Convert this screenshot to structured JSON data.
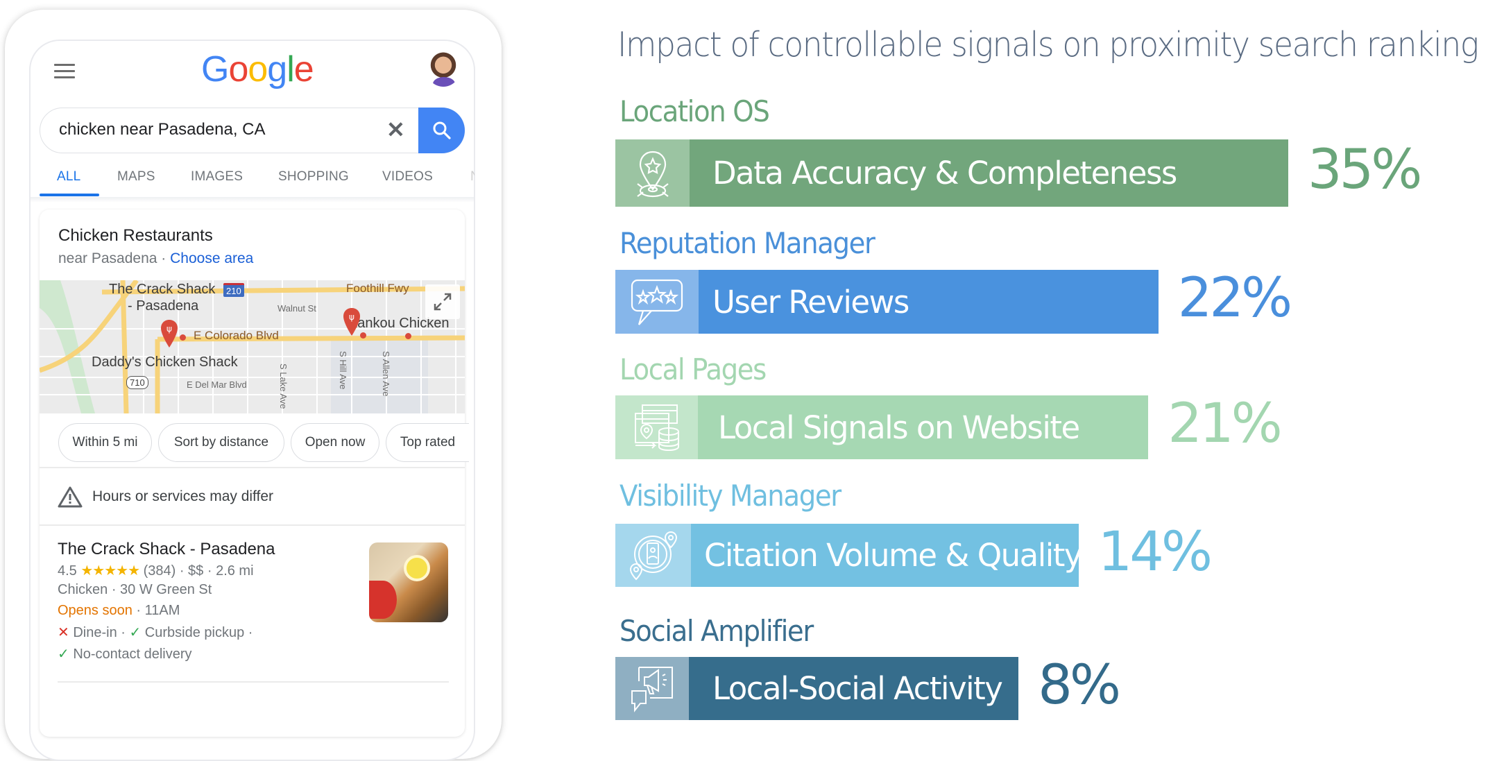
{
  "phone": {
    "brand": "Google",
    "search": {
      "query": "chicken near Pasadena, CA"
    },
    "tabs": [
      {
        "label": "ALL",
        "active": true
      },
      {
        "label": "MAPS",
        "active": false
      },
      {
        "label": "IMAGES",
        "active": false
      },
      {
        "label": "SHOPPING",
        "active": false
      },
      {
        "label": "VIDEOS",
        "active": false
      },
      {
        "label": "N",
        "active": false
      }
    ],
    "local_pack": {
      "title": "Chicken Restaurants",
      "subtitle_prefix": "near Pasadena · ",
      "choose_area": "Choose area",
      "map": {
        "labels": {
          "crack_shack_1": "The Crack Shack",
          "crack_shack_2": "- Pasadena",
          "zankou": "Zankou Chicken",
          "daddys": "Daddy's Chicken Shack",
          "foothill": "Foothill Fwy",
          "walnut": "Walnut St",
          "colorado": "E Colorado Blvd",
          "del_mar": "E Del Mar Blvd",
          "lake": "S Lake Ave",
          "hill": "S Hill Ave",
          "allen": "S Allen Ave",
          "i210": "210",
          "r710": "710"
        }
      },
      "chips": [
        "Within 5 mi",
        "Sort by distance",
        "Open now",
        "Top rated"
      ],
      "notice": "Hours or services may differ",
      "result": {
        "name": "The Crack Shack - Pasadena",
        "rating": "4.5",
        "stars": "★★★★★",
        "reviews_price_distance": "(384) · $$ · 2.6 mi",
        "category_address": "Chicken · 30 W Green St",
        "status": "Opens soon",
        "status_time": " · 11AM",
        "dine_in": "Dine-in · ",
        "curbside": "Curbside pickup ·",
        "delivery": "No-contact delivery",
        "x_mark": "✕",
        "check_mark": "✓"
      }
    }
  },
  "chart_data": {
    "type": "bar",
    "orientation": "horizontal",
    "title": "Impact of controllable signals on proximity search ranking",
    "categories": [
      "Data Accuracy & Completeness",
      "User Reviews",
      "Local Signals on Website",
      "Citation Volume & Quality",
      "Local-Social Activity"
    ],
    "groups": [
      "Location OS",
      "Reputation Manager",
      "Local Pages",
      "Visibility Manager",
      "Social Amplifier"
    ],
    "values": [
      35,
      22,
      21,
      14,
      8
    ],
    "value_labels": [
      "35%",
      "22%",
      "21%",
      "14%",
      "8%"
    ],
    "unit": "%",
    "icons": [
      "location-star-icon",
      "review-stars-icon",
      "website-database-icon",
      "citation-phone-icon",
      "megaphone-icon"
    ],
    "colors": {
      "bar": [
        "#72a67c",
        "#4a92de",
        "#a6d8b3",
        "#73c1e2",
        "#366d8c"
      ],
      "icon_segment": [
        "#9bc4a2",
        "#86b6ea",
        "#c3e6cb",
        "#a5d7ed",
        "#8fafc2"
      ],
      "group_label": [
        "#6aa57a",
        "#4a90d9",
        "#a3d6b0",
        "#6fbfe0",
        "#3a6e8e"
      ],
      "percent": [
        "#6aa57a",
        "#4a8fdc",
        "#a3d6b0",
        "#6fbfe0",
        "#336a8a"
      ]
    },
    "xlabel": "",
    "ylabel": "",
    "grid": false,
    "legend": "none"
  }
}
